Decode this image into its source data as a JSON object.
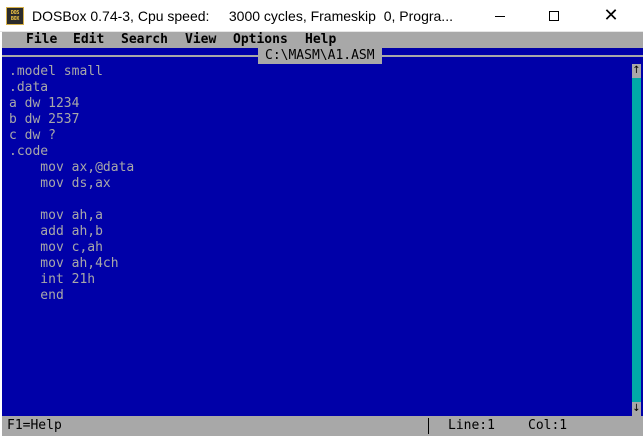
{
  "window": {
    "title": "DOSBox 0.74-3, Cpu speed:     3000 cycles, Frameskip  0, Progra...",
    "icon_label_top": "DOS",
    "icon_label_bottom": "BOX",
    "minimize_icon": "minimize-icon",
    "maximize_icon": "maximize-icon",
    "close_icon": "close-icon",
    "close_glyph": "✕"
  },
  "menu": {
    "items": [
      "File",
      "Edit",
      "Search",
      "View",
      "Options",
      "Help"
    ]
  },
  "editor": {
    "filename": "C:\\MASM\\A1.ASM",
    "lines": [
      ".model small",
      ".data",
      "a dw 1234",
      "b dw 2537",
      "c dw ?",
      ".code",
      "    mov ax,@data",
      "    mov ds,ax",
      "",
      "    mov ah,a",
      "    add ah,b",
      "    mov c,ah",
      "    mov ah,4ch",
      "    int 21h",
      "    end"
    ],
    "scroll_up_glyph": "↑",
    "scroll_down_glyph": "↓"
  },
  "status": {
    "help": "F1=Help",
    "line": "Line:1",
    "col": "Col:1"
  },
  "colors": {
    "dos_blue": "#0000a8",
    "dos_gray": "#a8a8a8",
    "dos_cyan": "#00a8a8"
  }
}
